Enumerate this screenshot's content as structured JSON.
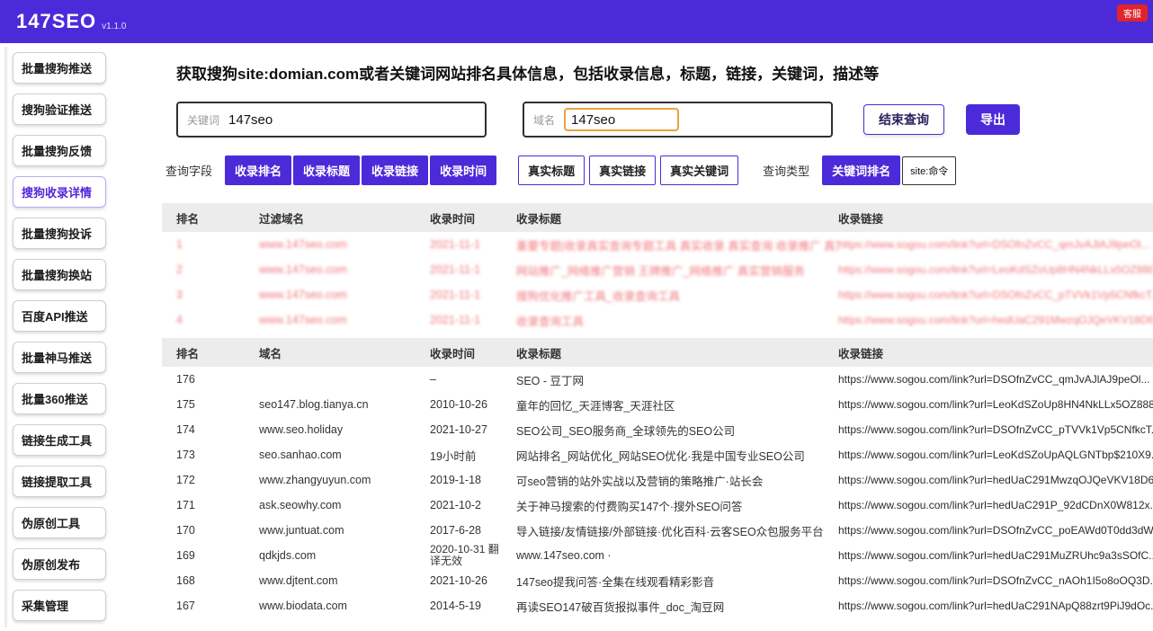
{
  "colors": {
    "accent": "#4b2bd9",
    "badge_red": "#e0242b",
    "redacted_pink": "#f2777d",
    "focus_orange": "#e8a33d"
  },
  "header": {
    "logo": "147SEO",
    "version": "v1.1.0",
    "badge": "客服"
  },
  "sidebar": {
    "items": [
      "批量搜狗推送",
      "搜狗验证推送",
      "批量搜狗反馈",
      "搜狗收录详情",
      "批量搜狗投诉",
      "批量搜狗换站",
      "百度API推送",
      "批量神马推送",
      "批量360推送",
      "链接生成工具",
      "链接提取工具",
      "伪原创工具",
      "伪原创发布",
      "采集管理"
    ]
  },
  "main": {
    "title": "获取搜狗site:domian.com或者关键词网站排名具体信息，包括收录信息，标题，链接，关键词，描述等",
    "search": {
      "keyword_label": "关键词",
      "keyword_value": "147seo",
      "domain_label": "域名",
      "domain_value": "147seo",
      "end_button": "结束查询",
      "export_button": "导出"
    },
    "filters": {
      "fields_label": "查询字段",
      "field_active": [
        "收录排名",
        "收录标题",
        "收录链接",
        "收录时间"
      ],
      "field_inactive": [
        "真实标题",
        "真实链接",
        "真实关键词"
      ],
      "type_label": "查询类型",
      "type_active": "关键词排名",
      "type_secondary": "site:命令"
    },
    "blurred_table": {
      "headers": [
        "排名",
        "过滤域名",
        "收录时间",
        "收录标题",
        "收录链接"
      ],
      "rows": [
        {
          "rank": "1",
          "domain": "www.147seo.com",
          "time": "2021-11-1",
          "title": "重要专题|收录真实查询专题工具 真实收录 真实查询 收录推广 真实关键词",
          "link": "https://www.sogou.com/link?url=DSOfnZvCC_qmJvAJlAJ9peOl..."
        },
        {
          "rank": "2",
          "domain": "www.147seo.com",
          "time": "2021-11-1",
          "title": "网站推广_网络推广营销 王牌推广_网络推广 真实营销服务",
          "link": "https://www.sogou.com/link?url=LeoKdSZoUp8HN4NkLLx5OZ888..."
        },
        {
          "rank": "3",
          "domain": "www.147seo.com",
          "time": "2021-11-1",
          "title": "搜狗优化推广工具_收录查询工具",
          "link": "https://www.sogou.com/link?url=DSOfnZvCC_pTVVk1Vp5CNfkcT..."
        },
        {
          "rank": "4",
          "domain": "www.147seo.com",
          "time": "2021-11-1",
          "title": "收录查询工具",
          "link": "https://www.sogou.com/link?url=hedUaC291MwzqOJQeVKV18D6..."
        }
      ]
    },
    "results_table": {
      "headers": [
        "排名",
        "域名",
        "收录时间",
        "收录标题",
        "收录链接"
      ],
      "rows": [
        {
          "rank": "176",
          "domain": "",
          "time": "–",
          "title": "SEO - 豆丁网",
          "link": "https://www.sogou.com/link?url=DSOfnZvCC_qmJvAJlAJ9peOl..."
        },
        {
          "rank": "175",
          "domain": "seo147.blog.tianya.cn",
          "time": "2010-10-26",
          "title": "童年的回忆_天涯博客_天涯社区",
          "link": "https://www.sogou.com/link?url=LeoKdSZoUp8HN4NkLLx5OZ888..."
        },
        {
          "rank": "174",
          "domain": "www.seo.holiday",
          "time": "2021-10-27",
          "title": "SEO公司_SEO服务商_全球领先的SEO公司",
          "link": "https://www.sogou.com/link?url=DSOfnZvCC_pTVVk1Vp5CNfkcT..."
        },
        {
          "rank": "173",
          "domain": "seo.sanhao.com",
          "time": "19小时前",
          "title": "网站排名_网站优化_网站SEO优化·我是中国专业SEO公司",
          "link": "https://www.sogou.com/link?url=LeoKdSZoUpAQLGNTbp$210X9..."
        },
        {
          "rank": "172",
          "domain": "www.zhangyuyun.com",
          "time": "2019-1-18",
          "title": "可seo营销的站外实战以及营销的策略推广·站长会",
          "link": "https://www.sogou.com/link?url=hedUaC291MwzqOJQeVKV18D6..."
        },
        {
          "rank": "171",
          "domain": "ask.seowhy.com",
          "time": "2021-10-2",
          "title": "关于神马搜索的付费购买147个·搜外SEO问答",
          "link": "https://www.sogou.com/link?url=hedUaC291P_92dCDnX0W812x..."
        },
        {
          "rank": "170",
          "domain": "www.juntuat.com",
          "time": "2017-6-28",
          "title": "导入链接/友情链接/外部链接·优化百科·云客SEO众包服务平台",
          "link": "https://www.sogou.com/link?url=DSOfnZvCC_poEAWd0T0dd3dW..."
        },
        {
          "rank": "169",
          "domain": "qdkjds.com",
          "time": "2020-10-31 翻译无效",
          "title": "www.147seo.com ·",
          "link": "https://www.sogou.com/link?url=hedUaC291MuZRUhc9a3sSOfC..."
        },
        {
          "rank": "168",
          "domain": "www.djtent.com",
          "time": "2021-10-26",
          "title": "147seo提我问答·全集在线观看精彩影音",
          "link": "https://www.sogou.com/link?url=DSOfnZvCC_nAOh1I5o8oOQ3D..."
        },
        {
          "rank": "167",
          "domain": "www.biodata.com",
          "time": "2014-5-19",
          "title": "再读SEO147破百货报拟事件_doc_淘豆网",
          "link": "https://www.sogou.com/link?url=hedUaC291NApQ88zrt9PiJ9dOc..."
        }
      ]
    }
  }
}
